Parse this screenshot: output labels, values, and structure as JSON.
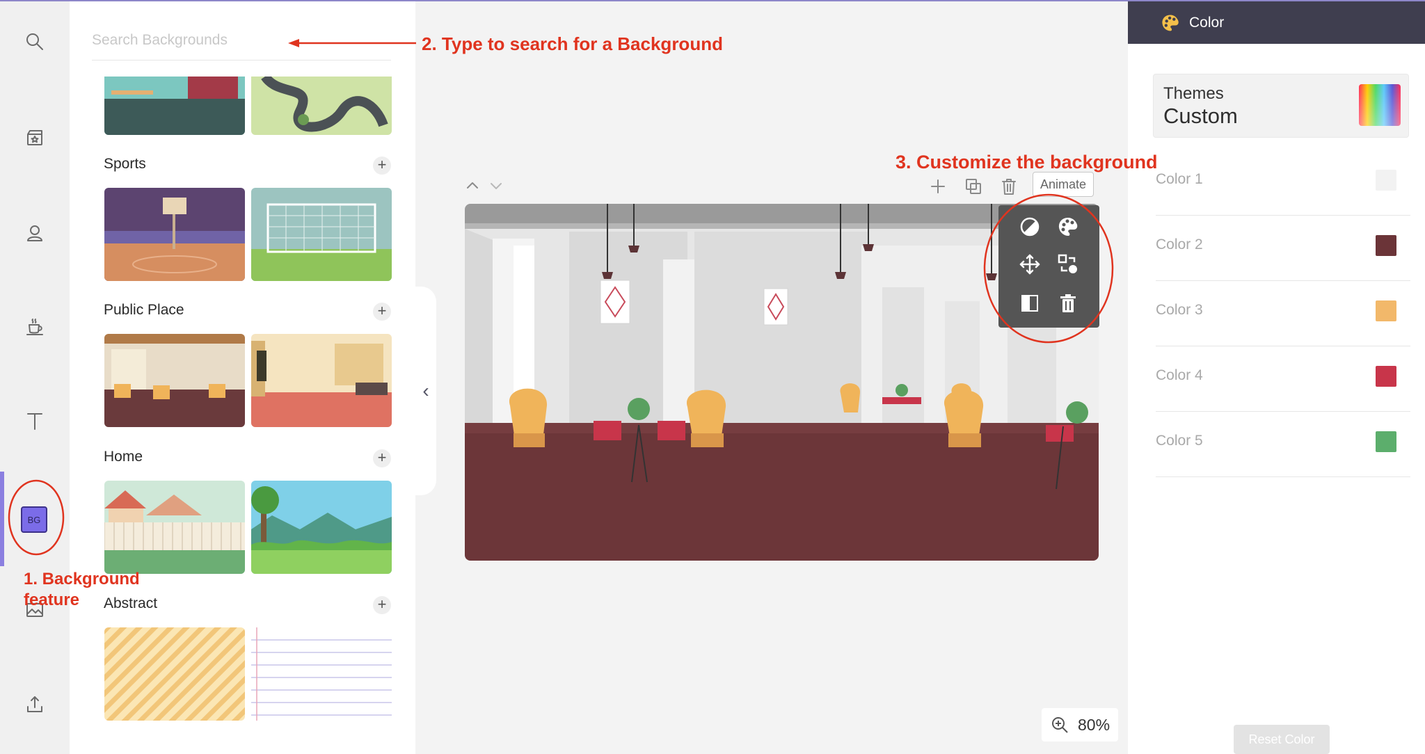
{
  "search": {
    "placeholder": "Search Backgrounds"
  },
  "categories": [
    {
      "label": "Sports"
    },
    {
      "label": "Public Place"
    },
    {
      "label": "Home"
    },
    {
      "label": "Abstract"
    }
  ],
  "sidebar": {
    "items": [
      {
        "icon": "search-icon"
      },
      {
        "icon": "scene-icon"
      },
      {
        "icon": "character-icon"
      },
      {
        "icon": "props-icon"
      },
      {
        "icon": "text-icon"
      },
      {
        "icon": "background-icon",
        "label": "BG",
        "active": true
      },
      {
        "icon": "image-icon"
      },
      {
        "icon": "upload-icon"
      }
    ]
  },
  "canvas_toolbar": {
    "animate_label": "Animate"
  },
  "zoom": {
    "value": "80%"
  },
  "right_panel": {
    "title": "Color",
    "themes_label": "Themes",
    "themes_value": "Custom",
    "colors": [
      {
        "label": "Color 1",
        "hex": "#f2f2f2"
      },
      {
        "label": "Color 2",
        "hex": "#6b3438"
      },
      {
        "label": "Color 3",
        "hex": "#f2b86a"
      },
      {
        "label": "Color 4",
        "hex": "#c8354a"
      },
      {
        "label": "Color 5",
        "hex": "#5cae6c"
      }
    ],
    "reset_label": "Reset Color"
  },
  "annotations": {
    "step1_line1": "1. Background",
    "step1_line2": "feature",
    "step2": "2. Type to search for a Background",
    "step3": "3. Customize the background"
  },
  "colors": {
    "accent": "#7b6ce8",
    "annotation": "#e0341f",
    "header": "#3f3e4f"
  }
}
